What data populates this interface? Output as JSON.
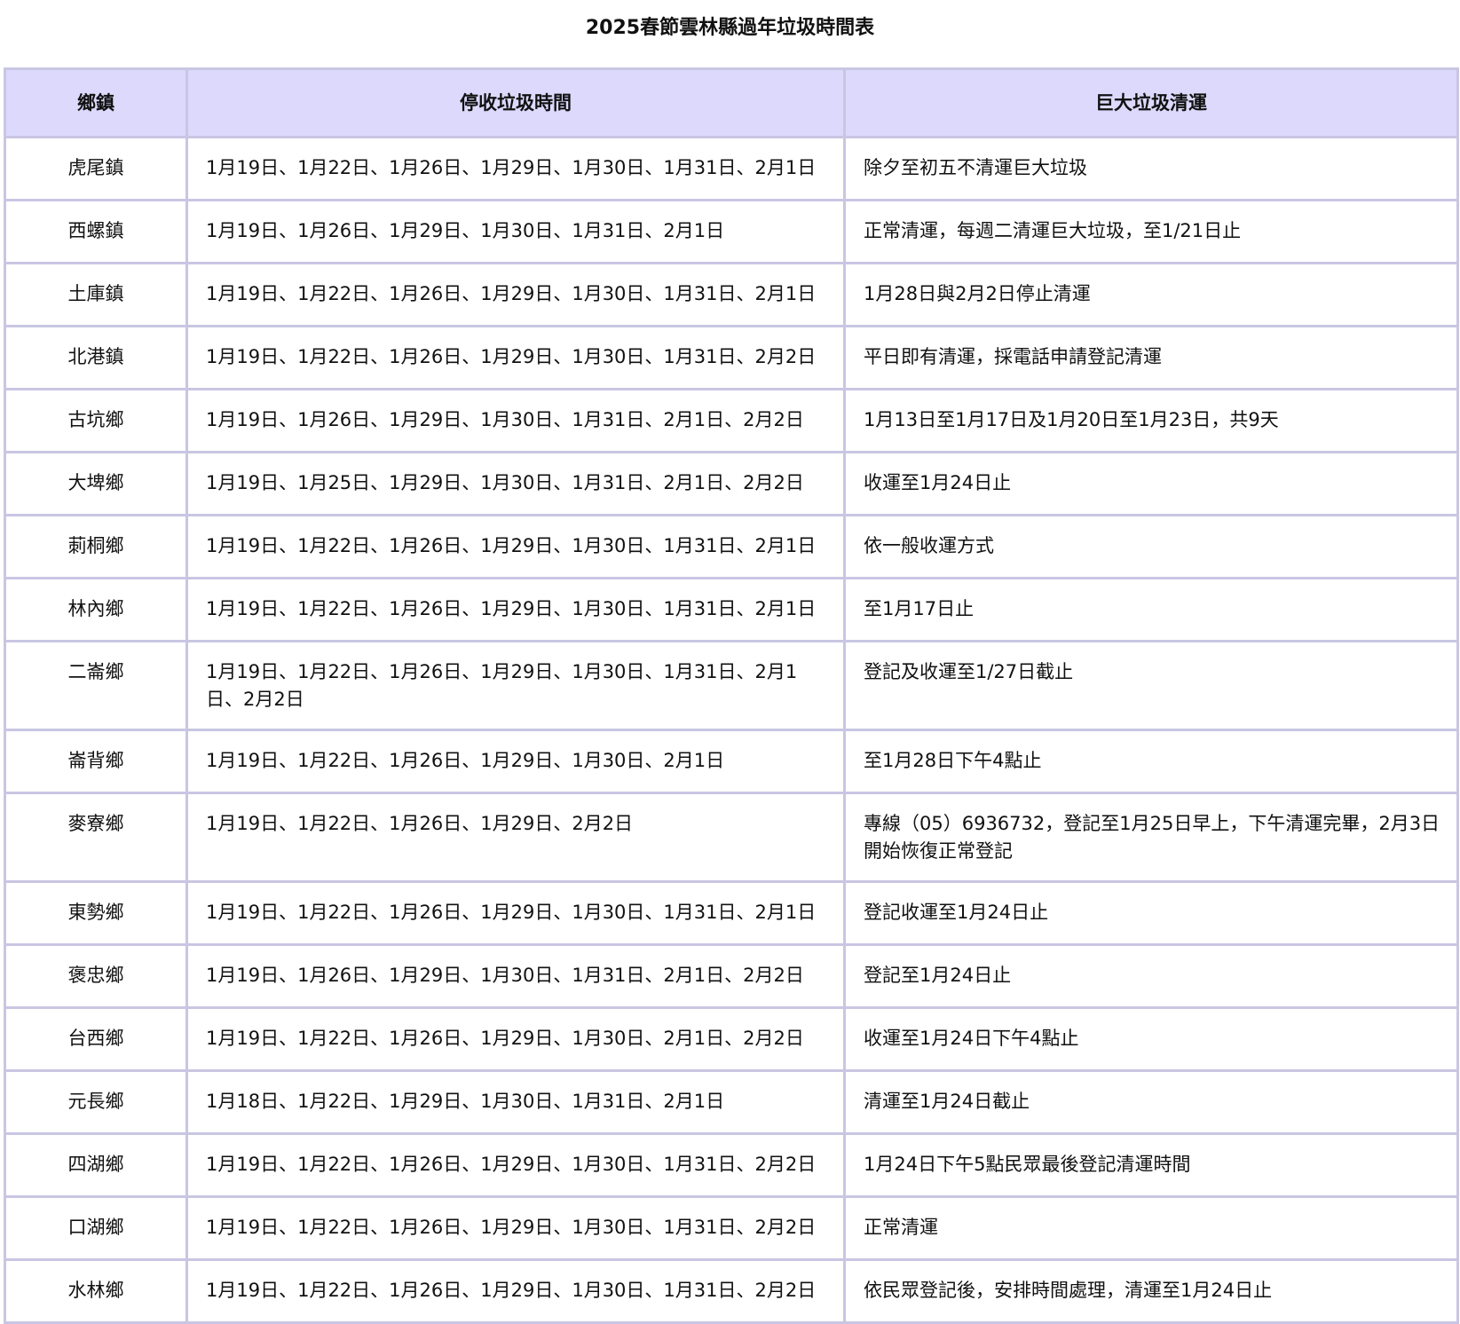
{
  "title": "2025春節雲林縣過年垃圾時間表",
  "columns": [
    "鄉鎮",
    "停收垃圾時間",
    "巨大垃圾清運"
  ],
  "rows": [
    {
      "town": "虎尾鎮",
      "stop": "1月19日、1月22日、1月26日、1月29日、1月30日、1月31日、2月1日",
      "bulky": "除夕至初五不清運巨大垃圾"
    },
    {
      "town": "西螺鎮",
      "stop": "1月19日、1月26日、1月29日、1月30日、1月31日、2月1日",
      "bulky": "正常清運，每週二清運巨大垃圾，至1/21日止"
    },
    {
      "town": "土庫鎮",
      "stop": "1月19日、1月22日、1月26日、1月29日、1月30日、1月31日、2月1日",
      "bulky": "1月28日與2月2日停止清運"
    },
    {
      "town": "北港鎮",
      "stop": "1月19日、1月22日、1月26日、1月29日、1月30日、1月31日、2月2日",
      "bulky": "平日即有清運，採電話申請登記清運"
    },
    {
      "town": "古坑鄉",
      "stop": "1月19日、1月26日、1月29日、1月30日、1月31日、2月1日、2月2日",
      "bulky": "1月13日至1月17日及1月20日至1月23日，共9天"
    },
    {
      "town": "大埤鄉",
      "stop": "1月19日、1月25日、1月29日、1月30日、1月31日、2月1日、2月2日",
      "bulky": "收運至1月24日止"
    },
    {
      "town": "莿桐鄉",
      "stop": "1月19日、1月22日、1月26日、1月29日、1月30日、1月31日、2月1日",
      "bulky": "依一般收運方式"
    },
    {
      "town": "林內鄉",
      "stop": "1月19日、1月22日、1月26日、1月29日、1月30日、1月31日、2月1日",
      "bulky": "至1月17日止"
    },
    {
      "town": "二崙鄉",
      "stop": "1月19日、1月22日、1月26日、1月29日、1月30日、1月31日、2月1日、2月2日",
      "bulky": "登記及收運至1/27日截止"
    },
    {
      "town": "崙背鄉",
      "stop": "1月19日、1月22日、1月26日、1月29日、1月30日、2月1日",
      "bulky": "至1月28日下午4點止"
    },
    {
      "town": "麥寮鄉",
      "stop": "1月19日、1月22日、1月26日、1月29日、2月2日",
      "bulky": "專線（05）6936732，登記至1月25日早上，下午清運完畢，2月3日開始恢復正常登記"
    },
    {
      "town": "東勢鄉",
      "stop": "1月19日、1月22日、1月26日、1月29日、1月30日、1月31日、2月1日",
      "bulky": "登記收運至1月24日止"
    },
    {
      "town": "褒忠鄉",
      "stop": "1月19日、1月26日、1月29日、1月30日、1月31日、2月1日、2月2日",
      "bulky": "登記至1月24日止"
    },
    {
      "town": "台西鄉",
      "stop": "1月19日、1月22日、1月26日、1月29日、1月30日、2月1日、2月2日",
      "bulky": "收運至1月24日下午4點止"
    },
    {
      "town": "元長鄉",
      "stop": "1月18日、1月22日、1月29日、1月30日、1月31日、2月1日",
      "bulky": "清運至1月24日截止"
    },
    {
      "town": "四湖鄉",
      "stop": "1月19日、1月22日、1月26日、1月29日、1月30日、1月31日、2月2日",
      "bulky": "1月24日下午5點民眾最後登記清運時間"
    },
    {
      "town": "口湖鄉",
      "stop": "1月19日、1月22日、1月26日、1月29日、1月30日、1月31日、2月2日",
      "bulky": "正常清運"
    },
    {
      "town": "水林鄉",
      "stop": "1月19日、1月22日、1月26日、1月29日、1月30日、1月31日、2月2日",
      "bulky": "依民眾登記後，安排時間處理，清運至1月24日止"
    }
  ]
}
